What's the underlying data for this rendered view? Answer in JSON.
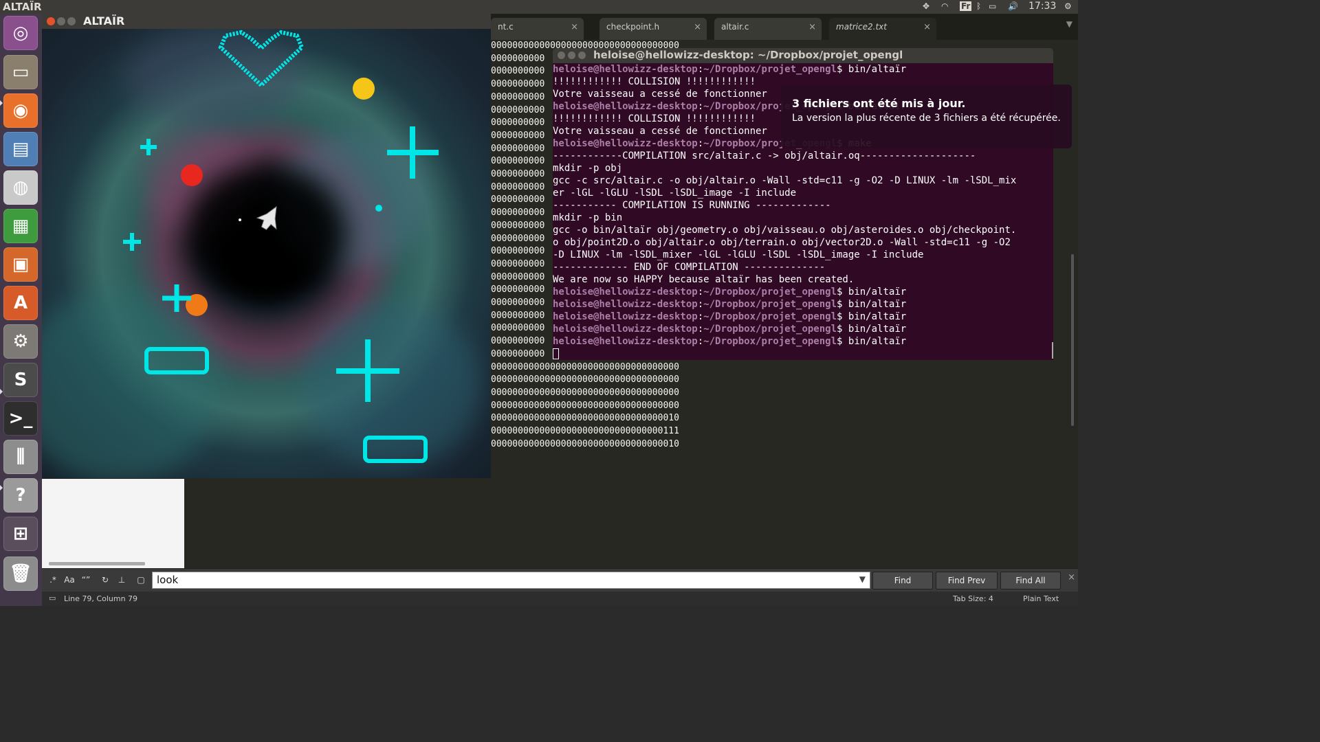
{
  "topbar": {
    "app_name": "ALTAÏR",
    "keyboard_layout": "Fr",
    "clock": "17:33"
  },
  "launcher": {
    "items": [
      {
        "name": "dash",
        "glyph": "◎",
        "color": "#8a4f8d"
      },
      {
        "name": "files",
        "glyph": "▭",
        "color": "#8a7f6c"
      },
      {
        "name": "firefox",
        "glyph": "◉",
        "color": "#e8702a"
      },
      {
        "name": "document-viewer",
        "glyph": "▤",
        "color": "#4f7fb4"
      },
      {
        "name": "chrome",
        "glyph": "◍",
        "color": "#c9c9c9"
      },
      {
        "name": "spreadsheet",
        "glyph": "▦",
        "color": "#3e9b3e"
      },
      {
        "name": "presentation",
        "glyph": "▣",
        "color": "#d5672a"
      },
      {
        "name": "software-center",
        "glyph": "A",
        "color": "#d65b28"
      },
      {
        "name": "system-settings",
        "glyph": "⚙",
        "color": "#7d7a76"
      },
      {
        "name": "sublime-text",
        "glyph": "S",
        "color": "#4b4b4b"
      },
      {
        "name": "terminal",
        "glyph": ">_",
        "color": "#2e2e2e"
      },
      {
        "name": "mixer",
        "glyph": "⫼",
        "color": "#8d8d8d"
      },
      {
        "name": "help",
        "glyph": "?",
        "color": "#9a9a9a"
      },
      {
        "name": "workspaces",
        "glyph": "⊞",
        "color": "#5a4d5c"
      },
      {
        "name": "trash",
        "glyph": "🗑",
        "color": "#8c8c8c"
      }
    ]
  },
  "editor": {
    "tabs": [
      {
        "label": "nt.c"
      },
      {
        "label": "checkpoint.h"
      },
      {
        "label": "altair.c"
      },
      {
        "label": "matrice2.txt"
      }
    ],
    "zero_lines": [
      "00000000000000000000000000000000000",
      "0000000000",
      "0000000000",
      "0000000000",
      "0000000000",
      "0000000000",
      "0000000000",
      "0000000000",
      "0000000000",
      "0000000000",
      "0000000000",
      "0000000000",
      "0000000000",
      "0000000000",
      "0000000000",
      "0000000000",
      "0000000000",
      "0000000000",
      "0000000000",
      "0000000000",
      "0000000000",
      "0000000000",
      "0000000000",
      "0000000000",
      "0000000000",
      "00000000000000000000000000000000000",
      "00000000000000000000000000000000000",
      "00000000000000000000000000000000000",
      "00000000000000000000000000000000000",
      "00000000000000000000000000000000010",
      "00000000000000000000000000000000111",
      "00000000000000000000000000000000010"
    ],
    "find": {
      "query": "look",
      "find_label": "Find",
      "find_prev_label": "Find Prev",
      "find_all_label": "Find All"
    },
    "status": {
      "position": "Line 79, Column 79",
      "tab_size": "Tab Size: 4",
      "syntax": "Plain Text"
    }
  },
  "game": {
    "title": "ALTAÏR",
    "colors": {
      "cyan": "#00e5e5",
      "yellow": "#f5c518",
      "red": "#e8281e",
      "orange": "#f07a18"
    }
  },
  "terminal": {
    "title": "heloise@hellowizz-desktop: ~/Dropbox/projet_opengl",
    "lines": [
      {
        "t": "prompt",
        "cmd": " bin/altaïr"
      },
      {
        "t": "text",
        "s": "!!!!!!!!!!!! COLLISION !!!!!!!!!!!!"
      },
      {
        "t": "text",
        "s": "Votre vaisseau a cessé de fonctionner"
      },
      {
        "t": "prompt",
        "cmd": " bin/altaïr"
      },
      {
        "t": "text",
        "s": "!!!!!!!!!!!! COLLISION !!!!!!!!!!!!"
      },
      {
        "t": "text",
        "s": "Votre vaisseau a cessé de fonctionner"
      },
      {
        "t": "prompt",
        "cmd": " make"
      },
      {
        "t": "text",
        "s": "------------COMPILATION src/altair.c -> obj/altair.oq--------------------"
      },
      {
        "t": "text",
        "s": "mkdir -p obj"
      },
      {
        "t": "text",
        "s": "gcc -c src/altair.c -o obj/altair.o -Wall -std=c11 -g -O2 -D LINUX -lm -lSDL_mix"
      },
      {
        "t": "text",
        "s": "er -lGL -lGLU -lSDL -lSDL_image -I include"
      },
      {
        "t": "text",
        "s": "----------- COMPILATION IS RUNNING -------------"
      },
      {
        "t": "text",
        "s": "mkdir -p bin"
      },
      {
        "t": "text",
        "s": "gcc -o bin/altaïr obj/geometry.o obj/vaisseau.o obj/asteroides.o obj/checkpoint."
      },
      {
        "t": "text",
        "s": "o obj/point2D.o obj/altair.o obj/terrain.o obj/vector2D.o -Wall -std=c11 -g -O2"
      },
      {
        "t": "text",
        "s": "-D LINUX -lm -lSDL_mixer -lGL -lGLU -lSDL -lSDL_image -I include"
      },
      {
        "t": "text",
        "s": "------------- END OF COMPILATION --------------"
      },
      {
        "t": "text",
        "s": "We are now so HAPPY because altaïr has been created."
      },
      {
        "t": "prompt",
        "cmd": " bin/altaïr"
      },
      {
        "t": "prompt",
        "cmd": " bin/altaïr"
      },
      {
        "t": "prompt",
        "cmd": " bin/altaïr"
      },
      {
        "t": "prompt",
        "cmd": " bin/altaïr"
      },
      {
        "t": "prompt",
        "cmd": " bin/altaïr"
      },
      {
        "t": "cursor"
      }
    ],
    "prompt_user": "heloise@hellowizz-desktop",
    "prompt_path": "~/Dropbox/projet_opengl"
  },
  "notification": {
    "heading": "3 fichiers ont été mis à jour.",
    "body": "La version la plus récente de 3 fichiers a été récupérée."
  }
}
